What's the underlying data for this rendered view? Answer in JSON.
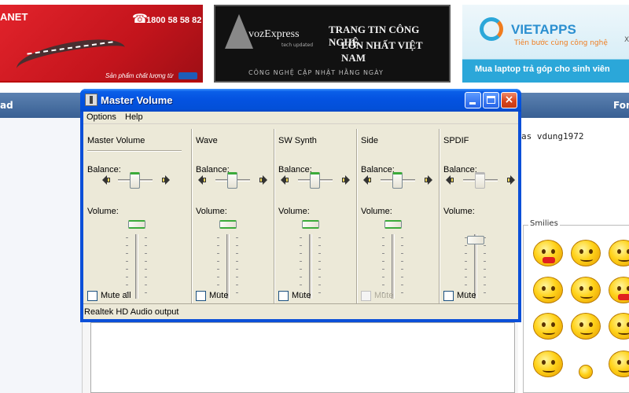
{
  "page": {
    "banners": {
      "left": {
        "brand": "ANET",
        "phone": "1800 58 58 82",
        "slogan": "Sản phẩm chất lượng từ"
      },
      "middle": {
        "logo": "vozExpress",
        "logo_sub": "tech updated",
        "headline1": "TRANG TIN CÔNG NGHỆ",
        "headline2": "LỚN NHẤT VIỆT NAM",
        "footer": "CÔNG NGHỆ CẬP NHẬT HẰNG NGÀY"
      },
      "right": {
        "brand": "VIETAPPS",
        "tagline": "Tiên bước cùng công nghệ",
        "bar": "Mua laptop trả góp cho sinh viên",
        "edge": "X"
      }
    },
    "forum_bar": {
      "left_text": "ad",
      "right_text": "For"
    },
    "post_snippet": "as vdung1972",
    "smilies_title": "Smilies"
  },
  "window": {
    "title": "Master Volume",
    "buttons": {
      "minimize_icon": "minimize-icon",
      "maximize_icon": "maximize-icon",
      "close_glyph": "×"
    },
    "menu": [
      "Options",
      "Help"
    ],
    "status": "Realtek HD Audio output",
    "balance_label": "Balance:",
    "volume_label": "Volume:",
    "channels": [
      {
        "name": "Master Volume",
        "mute_label": "Mute all",
        "mute_checked": false,
        "enabled": true,
        "balance": 0.5,
        "volume": 1.0
      },
      {
        "name": "Wave",
        "mute_label": "Mute",
        "mute_checked": false,
        "enabled": true,
        "balance": 0.5,
        "volume": 1.0
      },
      {
        "name": "SW Synth",
        "mute_label": "Mute",
        "mute_checked": false,
        "enabled": true,
        "balance": 0.5,
        "volume": 1.0
      },
      {
        "name": "Side",
        "mute_label": "Mute",
        "mute_checked": false,
        "enabled": true,
        "muted_disabled": true,
        "balance": 0.5,
        "volume": 1.0
      },
      {
        "name": "SPDIF",
        "mute_label": "Mute",
        "mute_checked": false,
        "enabled": false,
        "balance": 0.5,
        "volume": 0.75
      }
    ],
    "colors": {
      "titlebar": "#0452e0",
      "client": "#ece9d8",
      "accent_green": "#3bab3b"
    }
  }
}
